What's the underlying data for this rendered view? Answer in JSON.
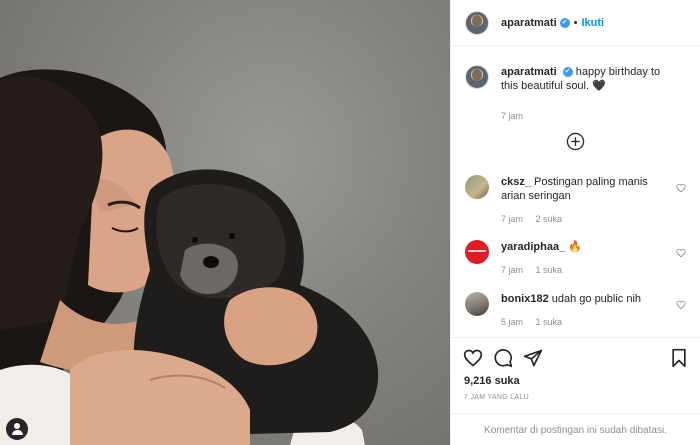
{
  "post": {
    "header": {
      "username": "aparatmati",
      "separator": "•",
      "follow_label": "Ikuti",
      "verified_glyph": "✔"
    },
    "caption": {
      "username": "aparatmati",
      "text": "happy birthday to this beautiful soul.",
      "emoji": "🖤",
      "time": "7 jam"
    },
    "load_more_icon": "plus-circle-icon",
    "comments": [
      {
        "username": "cksz_",
        "text": "Postingan paling manis arian seringan",
        "time": "7 jam",
        "likes": "2 suka",
        "avatar_color": "#9aa07e"
      },
      {
        "username": "yaradiphaa_",
        "text": "🔥",
        "time": "7 jam",
        "likes": "1 suka",
        "avatar_color": "#e01b24"
      },
      {
        "username": "bonix182",
        "text": "udah go public nih",
        "time": "5 jam",
        "likes": "1 suka",
        "avatar_color": "#7c756c"
      }
    ],
    "actions": {
      "icons": [
        "heart-icon",
        "comment-icon",
        "share-icon",
        "bookmark-icon"
      ],
      "likes_count": "9,216 suka",
      "timestamp": "7 JAM YANG LALU",
      "comments_limited": "Komentar di postingan ini sudah dibatasi."
    }
  },
  "colors": {
    "link_blue": "#0095f6",
    "verified_blue": "#3897f0",
    "muted": "#8e8e8e",
    "text": "#262626",
    "divider": "#efefef"
  }
}
